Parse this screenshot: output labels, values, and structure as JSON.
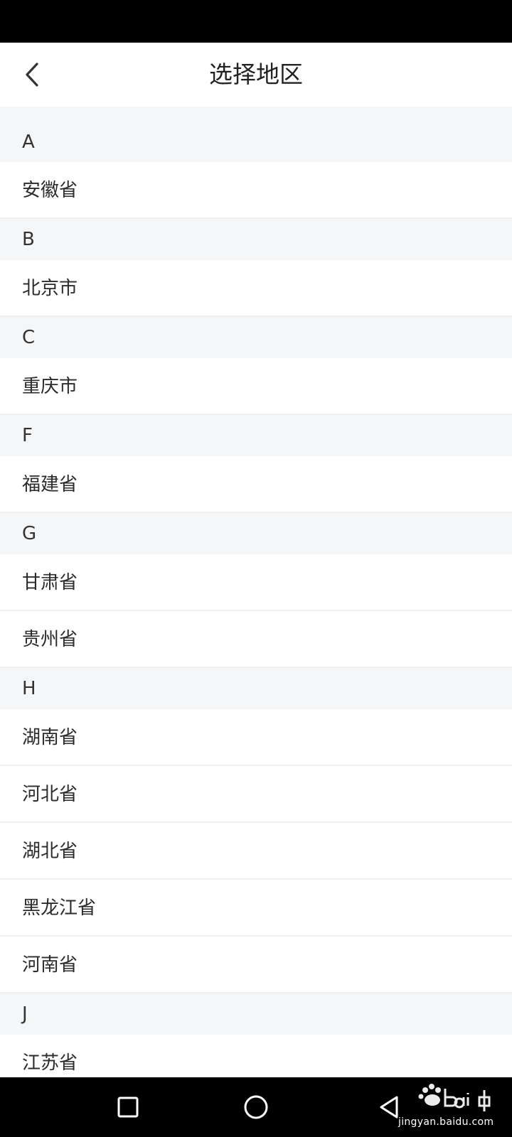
{
  "header": {
    "title": "选择地区",
    "back_icon": "chevron-left-icon"
  },
  "regions": [
    {
      "letter": "A",
      "items": [
        "安徽省"
      ]
    },
    {
      "letter": "B",
      "items": [
        "北京市"
      ]
    },
    {
      "letter": "C",
      "items": [
        "重庆市"
      ]
    },
    {
      "letter": "F",
      "items": [
        "福建省"
      ]
    },
    {
      "letter": "G",
      "items": [
        "甘肃省",
        "贵州省"
      ]
    },
    {
      "letter": "H",
      "items": [
        "湖南省",
        "河北省",
        "湖北省",
        "黑龙江省",
        "河南省"
      ]
    },
    {
      "letter": "J",
      "items": [
        "江苏省"
      ]
    }
  ],
  "nav_bar": {
    "recent_icon": "square-icon",
    "home_icon": "circle-icon",
    "back_icon": "triangle-back-icon"
  },
  "watermark": {
    "sub_text": "jingyan.baidu.com"
  },
  "colors": {
    "section_bg": "#f5f6f8",
    "divider": "#efefef",
    "bar_bg": "#000000"
  }
}
